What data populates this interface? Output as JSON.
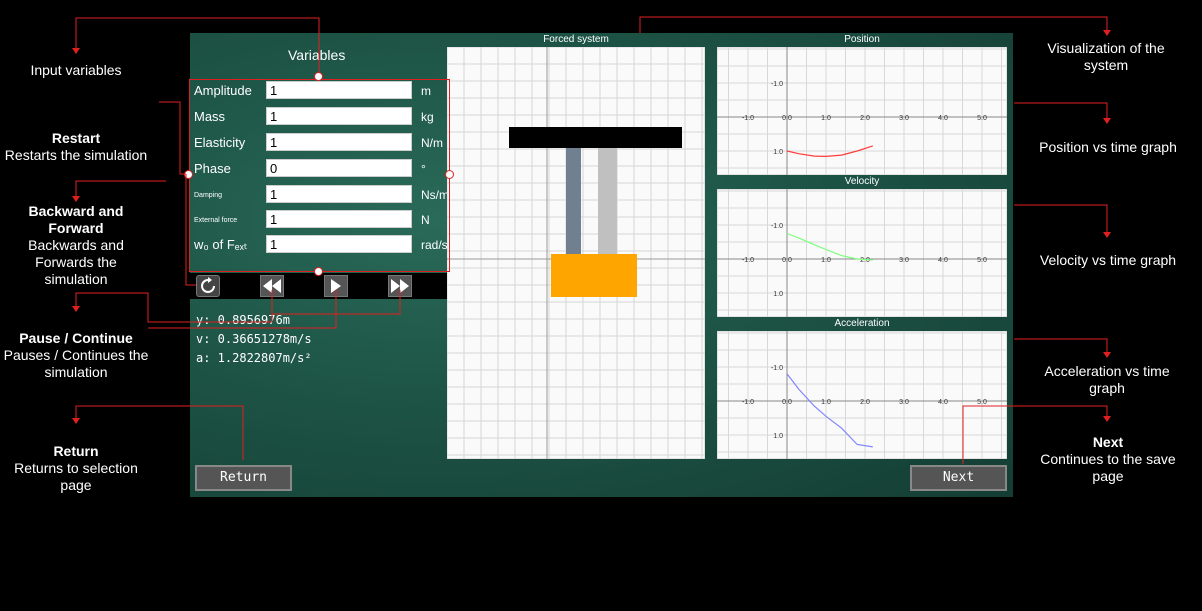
{
  "annotations": {
    "input_variables": "Input variables",
    "restart_title": "Restart",
    "restart_desc": "Restarts the simulation",
    "backward_forward_title": "Backward and Forward",
    "backward_forward_desc": "Backwards and Forwards the simulation",
    "pause_title": "Pause / Continue",
    "pause_desc": "Pauses / Continues the simulation",
    "return_title": "Return",
    "return_desc": "Returns to selection page",
    "visualization": "Visualization of the system",
    "position_graph": "Position vs time graph",
    "velocity_graph": "Velocity vs time graph",
    "acceleration_graph": "Acceleration vs time graph",
    "next_title": "Next",
    "next_desc": "Continues to the save page"
  },
  "variables": {
    "title": "Variables",
    "rows": [
      {
        "label": "Amplitude",
        "value": "1",
        "unit": "m"
      },
      {
        "label": "Mass",
        "value": "1",
        "unit": "kg"
      },
      {
        "label": "Elasticity",
        "value": "1",
        "unit": "N/m"
      },
      {
        "label": "Phase",
        "value": "0",
        "unit": "°"
      },
      {
        "label": "Damping",
        "value": "1",
        "unit": "Ns/m"
      },
      {
        "label": "External force",
        "value": "1",
        "unit": "N"
      },
      {
        "label": "w₀ of Fₑₓₜ",
        "value": "1",
        "unit": "rad/s"
      }
    ]
  },
  "controls": {
    "restart_icon": "restart-icon",
    "rewind_icon": "rewind-icon",
    "play_icon": "play-icon",
    "forward_icon": "fast-forward-icon"
  },
  "readouts": {
    "y": "y: 0.8956976m",
    "v": "v: 0.36651278m/s",
    "a": "a: 1.2822807m/s²"
  },
  "buttons": {
    "return": "Return",
    "next": "Next"
  },
  "panels": {
    "forced_system": "Forced system",
    "position": "Position",
    "velocity": "Velocity",
    "acceleration": "Acceleration"
  },
  "graph_ticks": {
    "x": [
      "-1.0",
      "0.0",
      "1.0",
      "2.0",
      "3.0",
      "4.0",
      "5.0"
    ],
    "y_top": "-1.0",
    "y_bottom": "1.0"
  },
  "colors": {
    "annotation_red": "#e02020",
    "position_curve": "#ff3b3b",
    "velocity_curve": "#7cff7c",
    "acceleration_curve": "#7f86ff",
    "mass_block": "#ffa500",
    "spring_dark": "#708090",
    "spring_light": "#c0c0c0"
  }
}
